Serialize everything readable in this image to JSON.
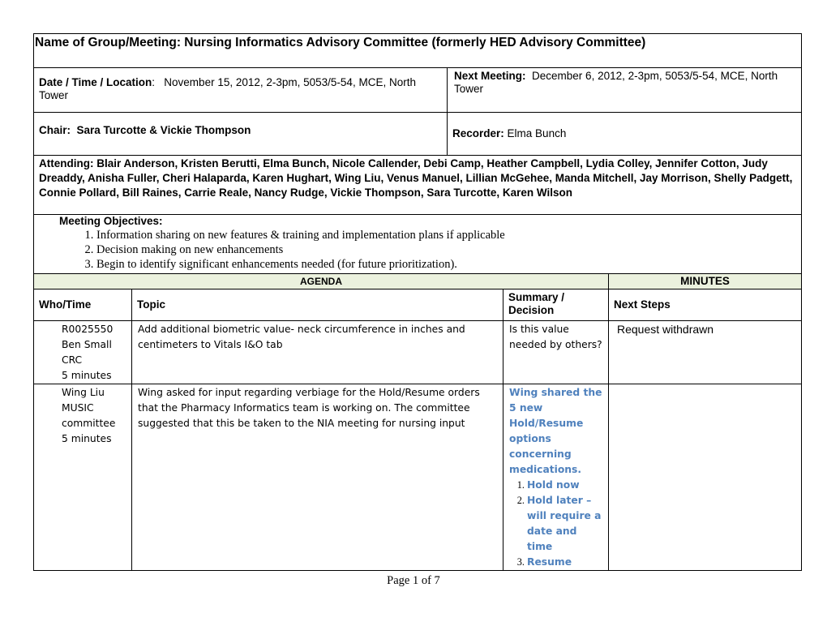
{
  "header": {
    "title_label": "Name of Group/Meeting:",
    "title_value": "Nursing Informatics Advisory Committee (formerly HED Advisory Committee)",
    "date_label": "Date / Time / Location",
    "date_value": "November 15, 2012, 2-3pm, 5053/5-54, MCE, North Tower",
    "next_meeting_label": "Next Meeting:",
    "next_meeting_value": "December 6, 2012, 2-3pm, 5053/5-54, MCE, North Tower",
    "chair_label": "Chair:",
    "chair_value": "Sara Turcotte & Vickie Thompson",
    "recorder_label": "Recorder:",
    "recorder_value": "Elma Bunch",
    "attending_label": "Attending:",
    "attending_value": "Blair Anderson, Kristen Berutti, Elma Bunch, Nicole Callender, Debi Camp, Heather Campbell, Lydia Colley, Jennifer Cotton, Judy Dreaddy, Anisha Fuller, Cheri Halaparda, Karen Hughart, Wing Liu, Venus Manuel, Lillian McGehee, Manda Mitchell, Jay Morrison, Shelly Padgett, Connie Pollard, Bill Raines, Carrie Reale, Nancy Rudge, Vickie Thompson, Sara Turcotte, Karen Wilson"
  },
  "objectives": {
    "heading": "Meeting Objectives:",
    "items": [
      "Information sharing on new features & training and implementation plans if applicable",
      "Decision making on new enhancements",
      "Begin to identify significant enhancements needed (for future prioritization)."
    ]
  },
  "table": {
    "agenda_label": "AGENDA",
    "minutes_label": "MINUTES",
    "columns": [
      "Who/Time",
      "Topic",
      "Summary / Decision",
      "Next Steps"
    ],
    "rows": [
      {
        "who": [
          "R0025550",
          "Ben Small",
          "CRC",
          "5 minutes"
        ],
        "topic": "Add additional biometric value- neck circumference in inches and centimeters to Vitals I&O tab",
        "summary": "Is this value needed by others?",
        "next_steps": "Request withdrawn"
      },
      {
        "who": [
          "Wing Liu",
          "MUSIC",
          "committee",
          "5 minutes"
        ],
        "topic": "Wing asked for input regarding verbiage for the Hold/Resume orders that the Pharmacy Informatics team is working on.   The committee suggested that this be taken to the NIA  meeting for nursing input",
        "summary": "Wing shared the 5 new Hold/Resume options concerning medications.",
        "summary_list": [
          "Hold now",
          "Hold later – will require a date and time",
          "Resume"
        ],
        "next_steps": ""
      }
    ]
  },
  "footer": {
    "page": "Page 1 of 7"
  },
  "colors": {
    "section_header_bg": "#ebf1de",
    "decision_text": "#4f81bd"
  }
}
